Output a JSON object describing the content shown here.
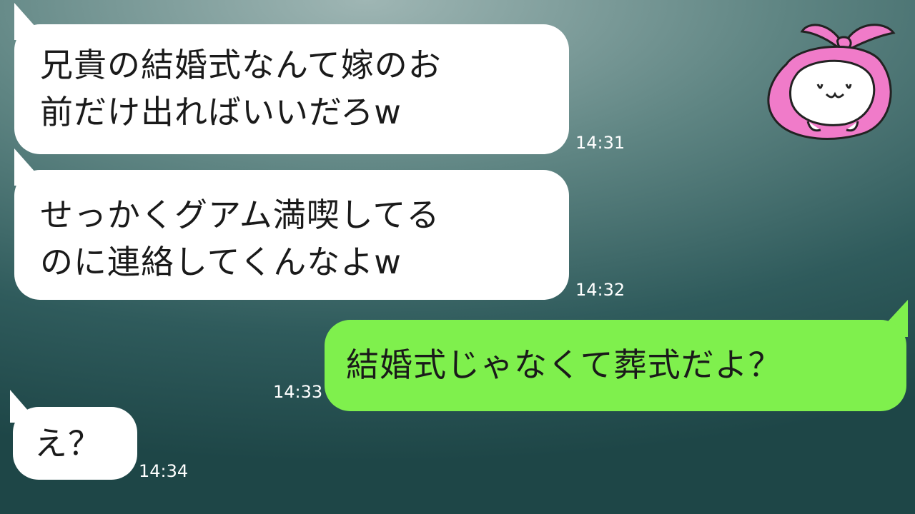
{
  "messages": [
    {
      "side": "left",
      "text": "兄貴の結婚式なんて嫁のお\n前だけ出ればいいだろw",
      "time": "14:31"
    },
    {
      "side": "left",
      "text": "せっかくグアム満喫してる\nのに連絡してくんなよw",
      "time": "14:32"
    },
    {
      "side": "right",
      "text": "結婚式じゃなくて葬式だよ？",
      "time": "14:33"
    },
    {
      "side": "left",
      "text": "え？",
      "time": "14:34"
    }
  ],
  "mascot": {
    "icon": "pink-bundle-mascot-icon",
    "color": "#f07bc9"
  },
  "colors": {
    "incoming_bubble": "#ffffff",
    "outgoing_bubble": "#7ff04d",
    "time_text": "#ffffff"
  }
}
